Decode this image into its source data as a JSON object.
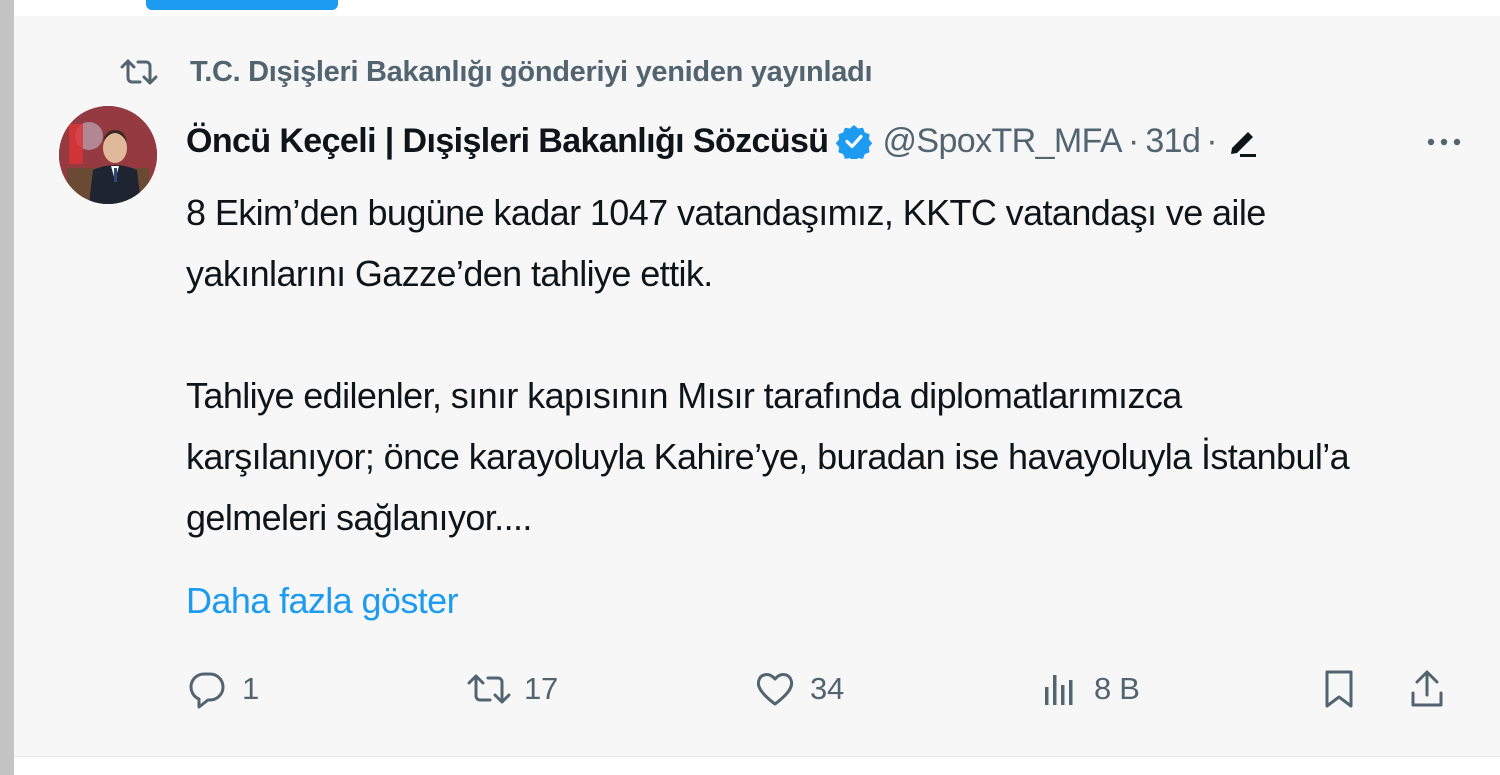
{
  "repost": {
    "text": "T.C. Dışişleri Bakanlığı gönderiyi yeniden yayınladı",
    "icon": "repost-icon"
  },
  "author": {
    "name": "Öncü Keçeli | Dışişleri Bakanlığı Sözcüsü",
    "handle": "@SpoxTR_MFA",
    "separator": "·",
    "time": "31d",
    "verified_color": "#1d9bf0"
  },
  "tweet": {
    "text": "8 Ekim’den bugüne kadar 1047 vatandaşımız, KKTC vatandaşı ve aile\nyakınlarını Gazze’den tahliye ettik.\n\nTahliye edilenler, sınır kapısının Mısır tarafında diplomatlarımızca\nkarşılanıyor; önce karayoluyla Kahire’ye, buradan ise havayoluyla İstanbul’a\ngelmeleri sağlanıyor....",
    "show_more": "Daha fazla göster"
  },
  "actions": {
    "replies": "1",
    "reposts": "17",
    "likes": "34",
    "views": "8 B"
  },
  "colors": {
    "accent": "#1d9bf0",
    "muted": "#536471",
    "text": "#0f1419",
    "background": "#f7f7f7"
  }
}
